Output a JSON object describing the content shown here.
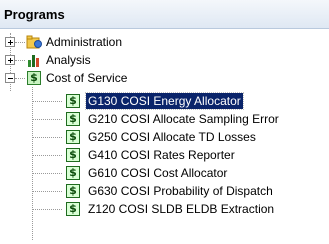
{
  "panel": {
    "title": "Programs"
  },
  "tree": {
    "items": [
      {
        "label": "Administration",
        "icon": "admin-folder-icon",
        "expanded": false
      },
      {
        "label": "Analysis",
        "icon": "bar-chart-icon",
        "expanded": false
      },
      {
        "label": "Cost of Service",
        "icon": "dollar-icon",
        "expanded": true,
        "children": [
          {
            "label": "G130 COSI Energy Allocator",
            "selected": true
          },
          {
            "label": "G210 COSI Allocate Sampling Error"
          },
          {
            "label": "G250 COSI Allocate TD Losses"
          },
          {
            "label": "G410 COSI Rates Reporter"
          },
          {
            "label": "G610 COSI Cost Allocator"
          },
          {
            "label": "G630 COSI Probability of Dispatch"
          },
          {
            "label": "Z120 COSI SLDB ELDB Extraction"
          }
        ]
      }
    ]
  },
  "colors": {
    "selection": "#0a246a",
    "header": "#dfe8f3",
    "icon_green": "#1f6b1f"
  }
}
